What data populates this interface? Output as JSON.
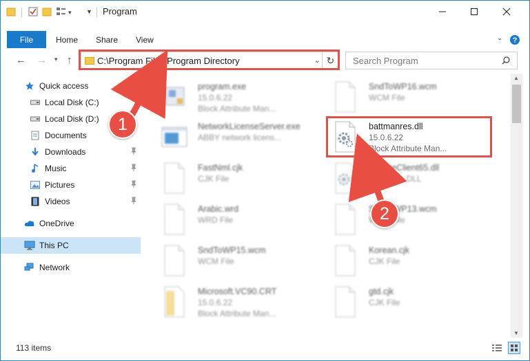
{
  "window": {
    "title": "Program"
  },
  "ribbon": {
    "tabs": [
      "File",
      "Home",
      "Share",
      "View"
    ]
  },
  "address": {
    "path": "C:\\Program Files\\Program Directory"
  },
  "search": {
    "placeholder": "Search Program"
  },
  "sidebar": {
    "items": [
      {
        "label": "Quick access",
        "icon": "star-icon"
      },
      {
        "label": "Local Disk (C:)",
        "icon": "drive-icon"
      },
      {
        "label": "Local Disk (D:)",
        "icon": "drive-icon"
      },
      {
        "label": "Documents",
        "icon": "documents-icon"
      },
      {
        "label": "Downloads",
        "icon": "download-icon",
        "pinned": true
      },
      {
        "label": "Music",
        "icon": "music-icon",
        "pinned": true
      },
      {
        "label": "Pictures",
        "icon": "pictures-icon",
        "pinned": true
      },
      {
        "label": "Videos",
        "icon": "videos-icon",
        "pinned": true
      },
      {
        "label": "OneDrive",
        "icon": "cloud-icon"
      },
      {
        "label": "This PC",
        "icon": "computer-icon",
        "selected": true
      },
      {
        "label": "Network",
        "icon": "network-icon"
      }
    ]
  },
  "files": [
    {
      "name": "program.exe",
      "line2": "15.0.6.22",
      "line3": "Block Attribute Man...",
      "icon": "exe-icon"
    },
    {
      "name": "SndToWP16.wcm",
      "line2": "WCM File",
      "line3": "",
      "icon": "file-icon"
    },
    {
      "name": "NetworkLicenseServer.exe",
      "line2": "ABBY network licens...",
      "line3": "",
      "icon": "app-window-icon"
    },
    {
      "name": "battmanres.dll",
      "line2": "15.0.6.22",
      "line3": "Block Attribute Man...",
      "icon": "dll-gear-icon"
    },
    {
      "name": "FastNml.cjk",
      "line2": "CJK File",
      "line3": "",
      "icon": "file-icon"
    },
    {
      "name": "UpdateClient65.dll",
      "line2": "Resource DLL",
      "line3": "",
      "icon": "dll-gear-icon"
    },
    {
      "name": "Arabic.wrd",
      "line2": "WRD File",
      "line3": "",
      "icon": "file-icon"
    },
    {
      "name": "SndToWP13.wcm",
      "line2": "WCM File",
      "line3": "",
      "icon": "file-icon"
    },
    {
      "name": "SndToWP15.wcm",
      "line2": "WCM File",
      "line3": "",
      "icon": "file-icon"
    },
    {
      "name": "Korean.cjk",
      "line2": "CJK File",
      "line3": "",
      "icon": "file-icon"
    },
    {
      "name": "Microsoft.VC90.CRT",
      "line2": "15.0.6.22",
      "line3": "Block Attribute Man...",
      "icon": "folder-file-icon"
    },
    {
      "name": "gtd.cjk",
      "line2": "CJK File",
      "line3": "",
      "icon": "file-icon"
    }
  ],
  "status": {
    "item_count": "113 items"
  },
  "annotations": {
    "step1": "1",
    "step2": "2",
    "highlight_color": "#d9534f",
    "badge_color": "#e84e43"
  }
}
